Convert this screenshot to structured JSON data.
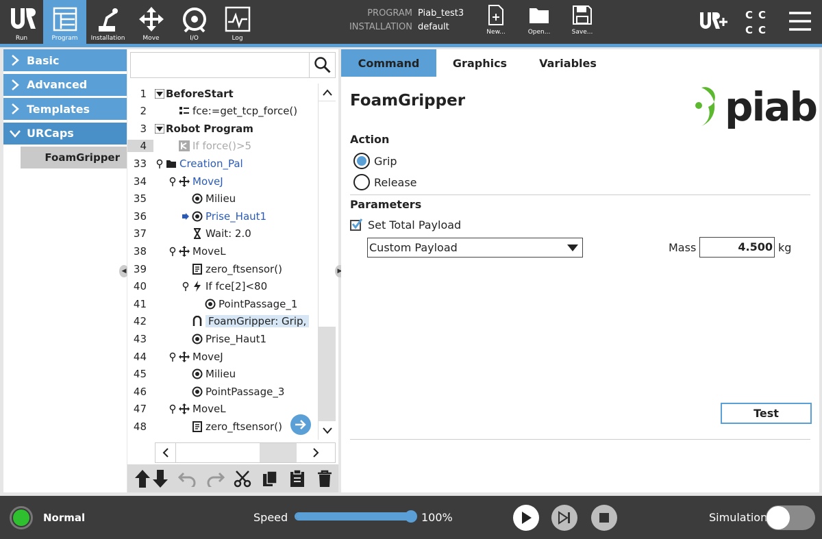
{
  "topbar": {
    "nav": [
      {
        "label": "Run",
        "icon": "ur-logo-icon"
      },
      {
        "label": "Program",
        "icon": "program-tree-icon",
        "active": true
      },
      {
        "label": "Installation",
        "icon": "robot-arm-icon"
      },
      {
        "label": "Move",
        "icon": "move-arrows-icon"
      },
      {
        "label": "I/O",
        "icon": "io-icon"
      },
      {
        "label": "Log",
        "icon": "log-pulse-icon"
      }
    ],
    "program_key": "PROGRAM",
    "program_value": "Piab_test3",
    "installation_key": "INSTALLATION",
    "installation_value": "default",
    "file_buttons": [
      {
        "label": "New...",
        "icon": "new-file-icon"
      },
      {
        "label": "Open...",
        "icon": "open-folder-icon"
      },
      {
        "label": "Save...",
        "icon": "save-disk-icon"
      }
    ],
    "cc_letters": [
      "C",
      "C",
      "C",
      "C"
    ]
  },
  "leftpanel": {
    "categories": [
      {
        "label": "Basic",
        "open": false
      },
      {
        "label": "Advanced",
        "open": false
      },
      {
        "label": "Templates",
        "open": false
      },
      {
        "label": "URCaps",
        "open": true
      }
    ],
    "subitem": "FoamGripper"
  },
  "tree": {
    "search_placeholder": "",
    "rows": [
      {
        "ln": "1",
        "indent": 0,
        "prefix": "triangle",
        "icon": "",
        "text": "BeforeStart",
        "style": "bold"
      },
      {
        "ln": "2",
        "indent": 1,
        "prefix": "",
        "icon": "assign-icon",
        "text": "fce:=get_tcp_force()",
        "style": ""
      },
      {
        "ln": "3",
        "indent": 0,
        "prefix": "triangle",
        "icon": "",
        "text": "Robot Program",
        "style": "bold"
      },
      {
        "ln": "4",
        "indent": 1,
        "prefix": "",
        "icon": "if-icon",
        "text": "If force()>5",
        "style": "grey",
        "highlight": true
      },
      {
        "ln": "33",
        "indent": 0,
        "prefix": "pin",
        "icon": "folder-icon",
        "text": "Creation_Pal",
        "style": "blue"
      },
      {
        "ln": "34",
        "indent": 1,
        "prefix": "pin",
        "icon": "move-icon",
        "text": "MoveJ",
        "style": "blue"
      },
      {
        "ln": "35",
        "indent": 2,
        "prefix": "",
        "icon": "waypoint-icon",
        "text": "Milieu",
        "style": ""
      },
      {
        "ln": "36",
        "indent": 2,
        "prefix": "arrow",
        "icon": "waypoint-icon",
        "text": "Prise_Haut1",
        "style": "blue"
      },
      {
        "ln": "37",
        "indent": 2,
        "prefix": "",
        "icon": "hourglass-icon",
        "text": "Wait: 2.0",
        "style": ""
      },
      {
        "ln": "38",
        "indent": 1,
        "prefix": "pin",
        "icon": "move-icon",
        "text": "MoveL",
        "style": ""
      },
      {
        "ln": "39",
        "indent": 2,
        "prefix": "",
        "icon": "script-icon",
        "text": "zero_ftsensor()",
        "style": ""
      },
      {
        "ln": "40",
        "indent": 2,
        "prefix": "pin",
        "icon": "lightning-icon",
        "text": "If fce[2]<80",
        "style": ""
      },
      {
        "ln": "41",
        "indent": 3,
        "prefix": "",
        "icon": "waypoint-icon",
        "text": "PointPassage_1",
        "style": ""
      },
      {
        "ln": "42",
        "indent": 2,
        "prefix": "",
        "icon": "gripper-icon",
        "text": "FoamGripper: Grip,",
        "style": "sel"
      },
      {
        "ln": "43",
        "indent": 2,
        "prefix": "",
        "icon": "waypoint-icon",
        "text": "Prise_Haut1",
        "style": ""
      },
      {
        "ln": "44",
        "indent": 1,
        "prefix": "pin",
        "icon": "move-icon",
        "text": "MoveJ",
        "style": ""
      },
      {
        "ln": "45",
        "indent": 2,
        "prefix": "",
        "icon": "waypoint-icon",
        "text": "Milieu",
        "style": ""
      },
      {
        "ln": "46",
        "indent": 2,
        "prefix": "",
        "icon": "waypoint-icon",
        "text": "PointPassage_3",
        "style": ""
      },
      {
        "ln": "47",
        "indent": 1,
        "prefix": "pin",
        "icon": "move-icon",
        "text": "MoveL",
        "style": ""
      },
      {
        "ln": "48",
        "indent": 2,
        "prefix": "",
        "icon": "script-icon",
        "text": "zero_ftsensor()",
        "style": ""
      }
    ]
  },
  "rightpanel": {
    "tabs": [
      {
        "label": "Command",
        "active": true
      },
      {
        "label": "Graphics",
        "active": false
      },
      {
        "label": "Variables",
        "active": false
      }
    ],
    "title": "FoamGripper",
    "logo_text": "piab",
    "action_title": "Action",
    "action_options": [
      {
        "label": "Grip",
        "selected": true
      },
      {
        "label": "Release",
        "selected": false
      }
    ],
    "parameters_title": "Parameters",
    "payload_checkbox_label": "Set Total Payload",
    "payload_checked": true,
    "payload_dropdown_value": "Custom Payload",
    "mass_label": "Mass",
    "mass_value": "4.500",
    "mass_unit": "kg",
    "test_button": "Test"
  },
  "bottombar": {
    "status": "Normal",
    "status_color": "#2fc02f",
    "speed_label": "Speed",
    "speed_value": 100,
    "speed_text": "100%",
    "simulation_label": "Simulation",
    "simulation_on": false
  },
  "colors": {
    "accent": "#5aa0d6",
    "topbar": "#3c3c3c",
    "link": "#2a5ab8"
  }
}
